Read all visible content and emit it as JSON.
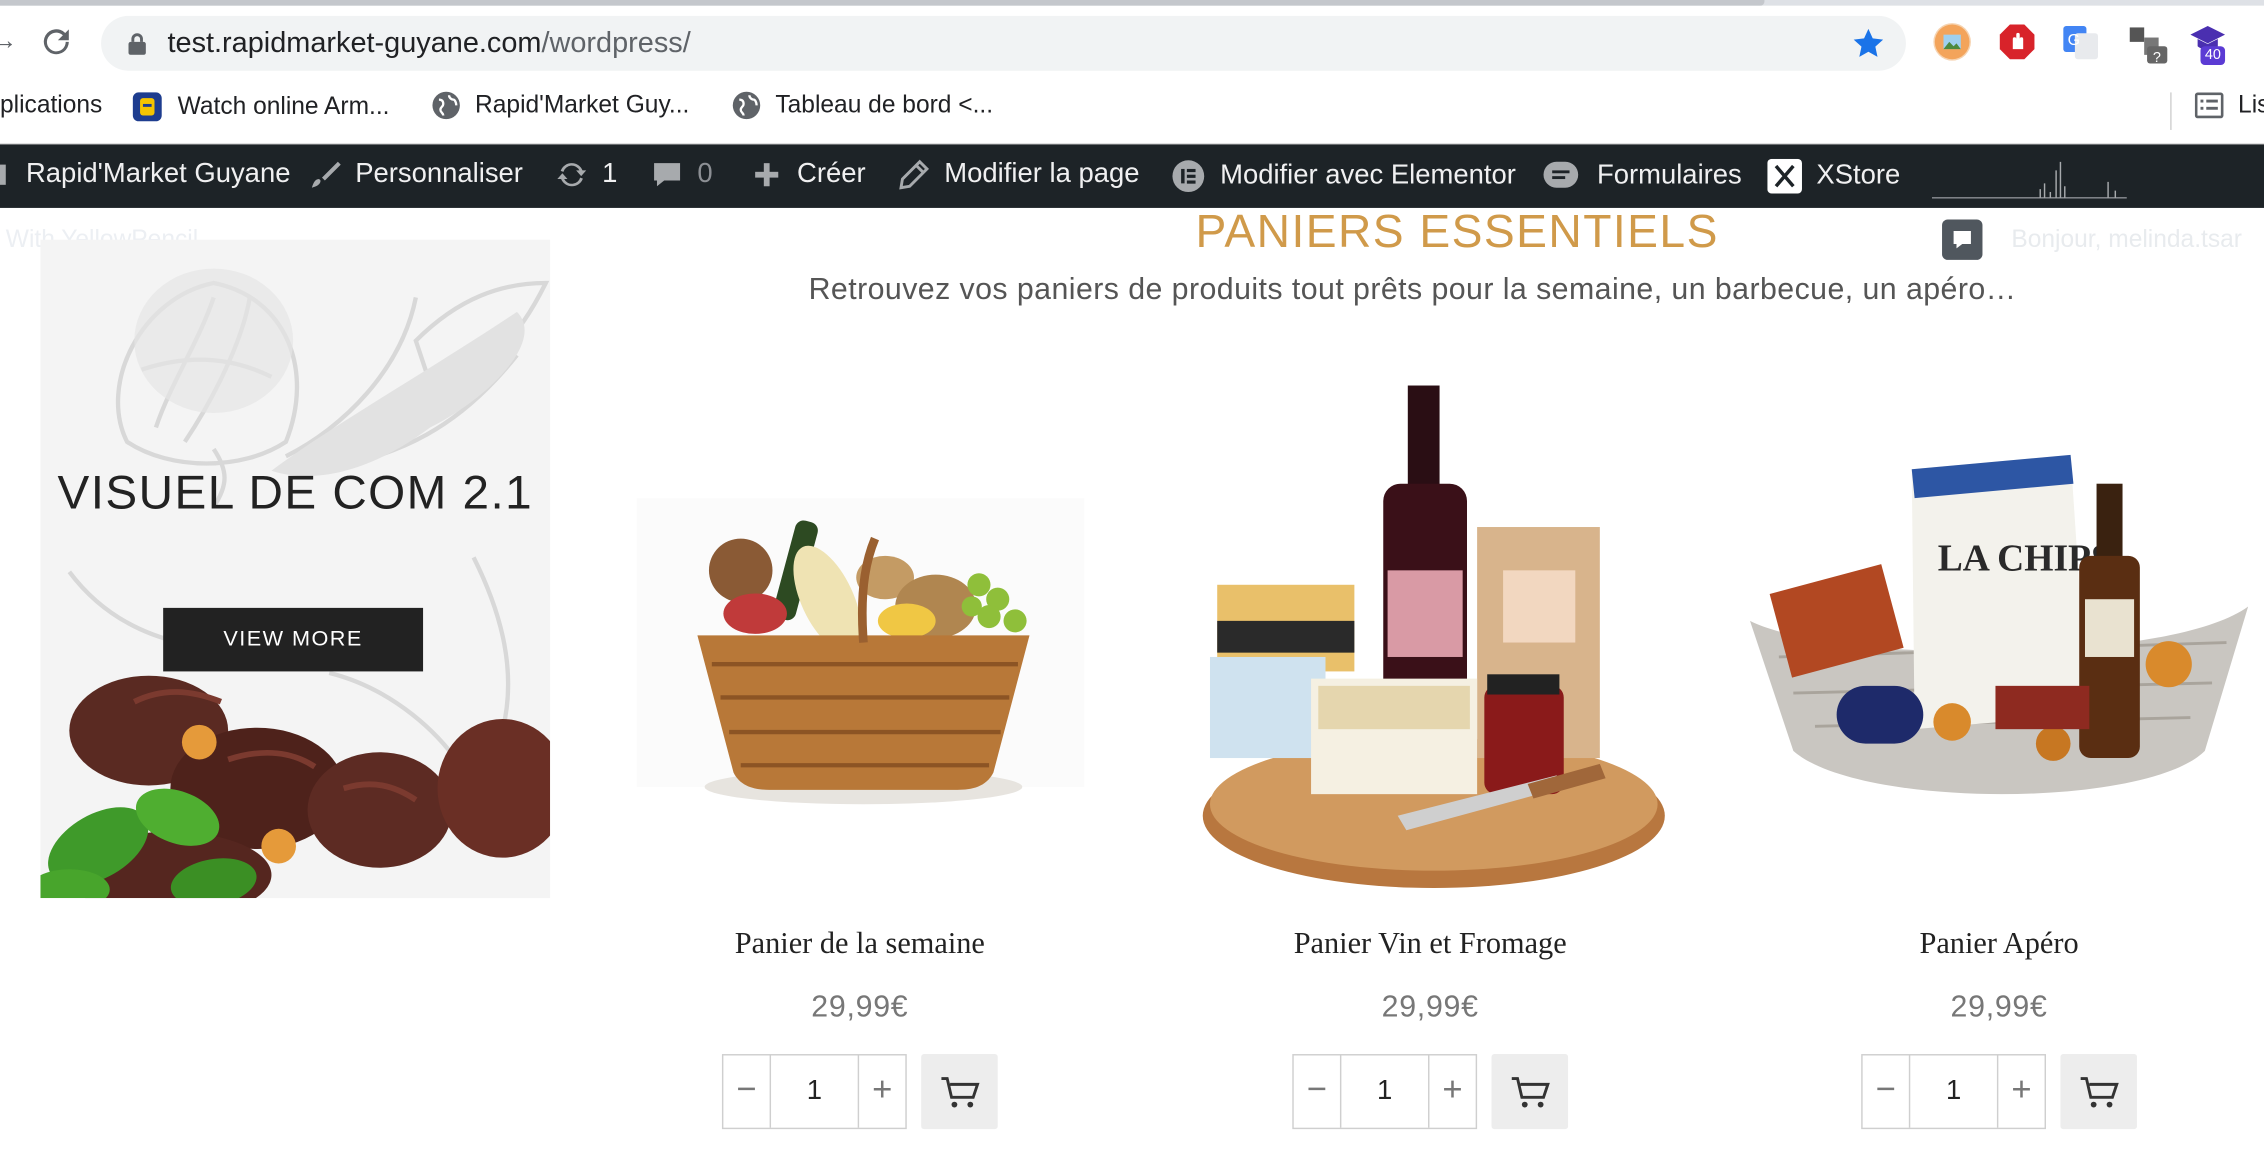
{
  "browser": {
    "url_domain": "test.rapidmarket-guyane.com",
    "url_path": "/wordpress/",
    "bookmarks": [
      {
        "label": "plications"
      },
      {
        "label": "Watch online Arm..."
      },
      {
        "label": "Rapid'Market Guy..."
      },
      {
        "label": "Tableau de bord <..."
      },
      {
        "label": "Lis"
      }
    ],
    "extension_badge": "40"
  },
  "adminbar": {
    "site": "Rapid'Market Guyane",
    "customize": "Personnaliser",
    "updates_count": "1",
    "comments_count": "0",
    "create": "Créer",
    "edit_page": "Modifier la page",
    "edit_elementor": "Modifier avec Elementor",
    "forms": "Formulaires",
    "xstore": "XStore"
  },
  "overlay": {
    "yellowpencil": "With YellowPencil",
    "greeting": "Bonjour, melinda.tsar"
  },
  "promo": {
    "title": "VISUEL DE COM 2.1",
    "button": "VIEW MORE"
  },
  "section": {
    "title": "PANIERS ESSENTIELS",
    "subtitle": "Retrouvez vos paniers de produits tout prêts pour la semaine, un barbecue, un apéro…"
  },
  "products": [
    {
      "name": "Panier de la semaine",
      "price": "29,99€",
      "qty": "1"
    },
    {
      "name": "Panier Vin et Fromage",
      "price": "29,99€",
      "qty": "1"
    },
    {
      "name": "Panier Apéro",
      "price": "29,99€",
      "qty": "1"
    }
  ],
  "qty_controls": {
    "minus": "−",
    "plus": "+"
  },
  "colors": {
    "accent": "#d09a4a",
    "adminbar": "#1d2327",
    "chrome_star": "#1a73e8"
  }
}
